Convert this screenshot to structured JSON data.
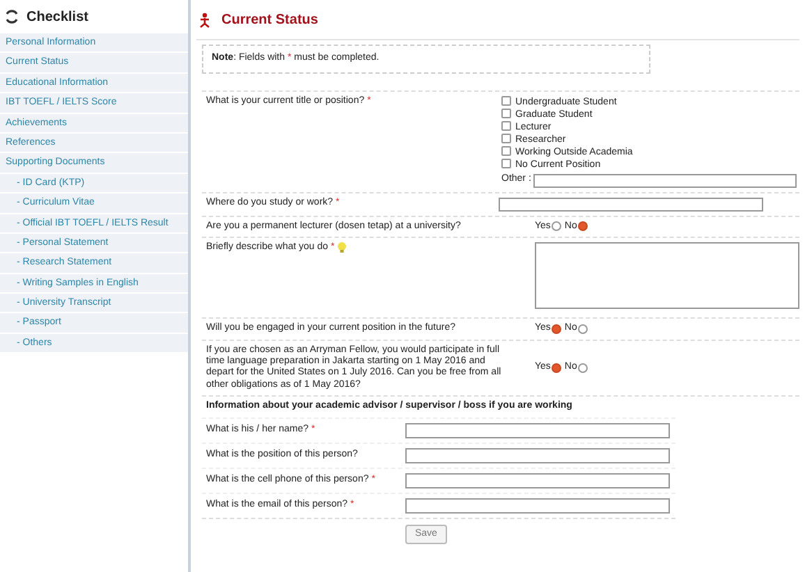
{
  "sidebar": {
    "title": "Checklist",
    "items": [
      {
        "label": "Personal Information"
      },
      {
        "label": "Current Status"
      },
      {
        "label": "Educational Information"
      },
      {
        "label": "IBT TOEFL / IELTS Score"
      },
      {
        "label": "Achievements"
      },
      {
        "label": "References"
      },
      {
        "label": "Supporting Documents",
        "children": [
          {
            "label": "- ID Card (KTP)"
          },
          {
            "label": "- Curriculum Vitae"
          },
          {
            "label": "- Official IBT TOEFL / IELTS Result"
          },
          {
            "label": "- Personal Statement"
          },
          {
            "label": "- Research Statement"
          },
          {
            "label": "- Writing Samples in English"
          },
          {
            "label": "- University Transcript"
          },
          {
            "label": "- Passport"
          },
          {
            "label": "- Others"
          }
        ]
      }
    ]
  },
  "page_title": "Current Status",
  "note": {
    "before": "**Note**: Fields with ",
    "mark": "*",
    "after": " must be completed."
  },
  "questions": [
    {
      "kind": "checkboxes",
      "label": "What is your current title or position?",
      "mark": "*",
      "options": [
        {
          "label": "Undergraduate Student",
          "checked": false
        },
        {
          "label": "Graduate Student",
          "checked": false
        },
        {
          "label": "Lecturer",
          "checked": false
        },
        {
          "label": "Researcher",
          "checked": false
        },
        {
          "label": "Working Outside Academia",
          "checked": false
        },
        {
          "label": "No Current Position",
          "checked": false
        }
      ],
      "other_label": "Other :"
    },
    {
      "kind": "text",
      "label": "Where do you study or work?",
      "mark": "*"
    },
    {
      "kind": "radio",
      "label": "Are you a permanent lecturer (dosen tetap) at a university?",
      "options": [
        {
          "label": "Yes",
          "selected": false
        },
        {
          "label": "No",
          "selected": true
        }
      ]
    },
    {
      "kind": "textarea",
      "label": "Briefly describe what you do",
      "mark": "*",
      "hint": true
    },
    {
      "kind": "radio",
      "label": "Will you be engaged in your current position in the future?",
      "options": [
        {
          "label": "Yes",
          "selected": true
        },
        {
          "label": "No",
          "selected": false
        }
      ]
    },
    {
      "kind": "radio",
      "label": "If you are chosen as an Arryman Fellow, you would participate in full time language preparation in Jakarta starting on 1 May 2016 and depart for the United States on 1 July 2016. Can you be free from all other obligations as of 1 May 2016?",
      "options": [
        {
          "label": "Yes",
          "selected": true
        },
        {
          "label": "No",
          "selected": false
        }
      ]
    }
  ],
  "advisor": {
    "heading": "Information about your academic advisor / supervisor / boss if you are working",
    "questions": [
      {
        "label": "What is his / her name?",
        "mark": "*"
      },
      {
        "label": "What is the position of this person?"
      },
      {
        "label": "What is the cell phone of this person?",
        "mark": "*"
      },
      {
        "label": "What is the email of this person?",
        "mark": "*"
      }
    ]
  },
  "save_button": "Save"
}
